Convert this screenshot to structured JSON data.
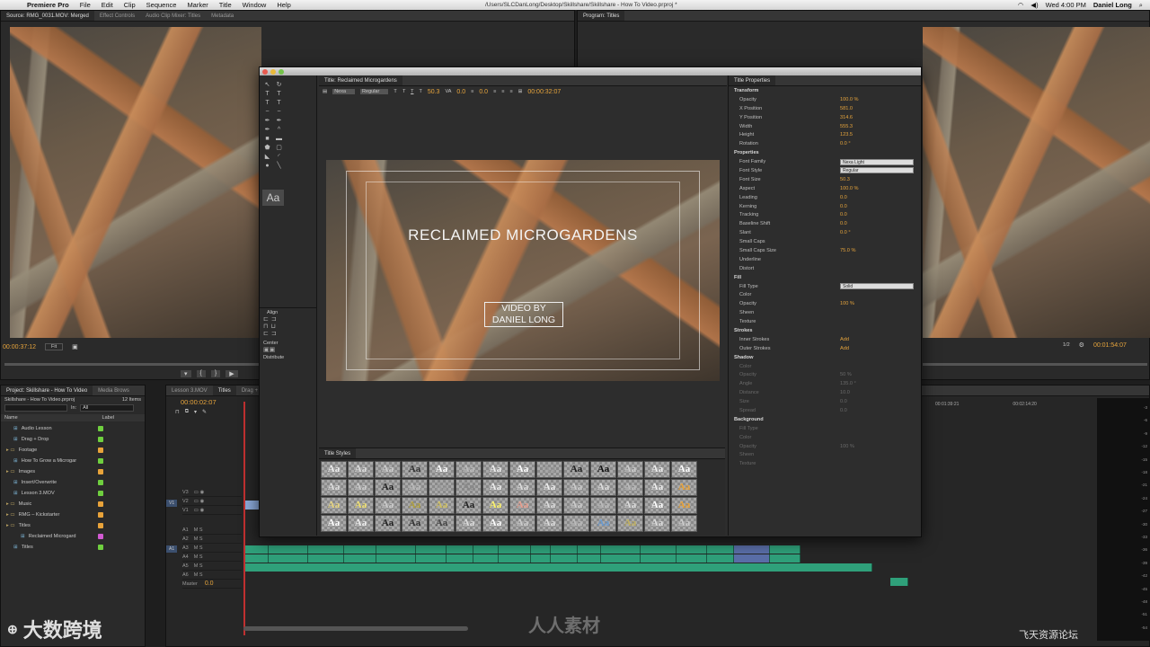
{
  "menubar": {
    "app": "Premiere Pro",
    "items": [
      "File",
      "Edit",
      "Clip",
      "Sequence",
      "Marker",
      "Title",
      "Window",
      "Help"
    ],
    "path": "/Users/SLCDanLong/Desktop/Skillshare/Skillshare - How To Video.prproj *",
    "clock": "Wed 4:00 PM",
    "user": "Daniel Long"
  },
  "source": {
    "tabs": [
      "Source: RMG_0031.MOV: Merged",
      "Effect Controls",
      "Audio Clip Mixer: Titles",
      "Metadata"
    ],
    "timecode": "00:00:37:12",
    "zoom": "Fit"
  },
  "program": {
    "tab": "Program: Titles",
    "timecode": "00:01:54:07",
    "ratio": "1/2"
  },
  "title": {
    "tab": "Title: Reclaimed Microgardens",
    "font": "Nexa",
    "style": "Regular",
    "size": "50.3",
    "kerning": "0.0",
    "leading": "0.0",
    "tc": "00:00:32:07",
    "main_text": "RECLAIMED MICROGARDENS",
    "sub_text": "VIDEO BY DANIEL LONG",
    "style_char": "Aa",
    "styles_tab": "Title Styles",
    "align": "Align",
    "center": "Center",
    "distribute": "Distribute"
  },
  "props": {
    "tab": "Title Properties",
    "rows": [
      {
        "n": "Transform",
        "v": "",
        "t": "sec"
      },
      {
        "n": "Opacity",
        "v": "100.0 %"
      },
      {
        "n": "X Position",
        "v": "581.0"
      },
      {
        "n": "Y Position",
        "v": "314.6"
      },
      {
        "n": "Width",
        "v": "555.3"
      },
      {
        "n": "Height",
        "v": "123.5"
      },
      {
        "n": "Rotation",
        "v": "0.0 °"
      },
      {
        "n": "Properties",
        "v": "",
        "t": "sec"
      },
      {
        "n": "Font Family",
        "v": "Nexa Light",
        "t": "sel"
      },
      {
        "n": "Font Style",
        "v": "Regular",
        "t": "sel"
      },
      {
        "n": "Font Size",
        "v": "50.3"
      },
      {
        "n": "Aspect",
        "v": "100.0 %"
      },
      {
        "n": "Leading",
        "v": "0.0"
      },
      {
        "n": "Kerning",
        "v": "0.0"
      },
      {
        "n": "Tracking",
        "v": "0.0"
      },
      {
        "n": "Baseline Shift",
        "v": "0.0"
      },
      {
        "n": "Slant",
        "v": "0.0 °"
      },
      {
        "n": "Small Caps",
        "v": ""
      },
      {
        "n": "Small Caps Size",
        "v": "75.0 %"
      },
      {
        "n": "Underline",
        "v": ""
      },
      {
        "n": "Distort",
        "v": ""
      },
      {
        "n": "Fill",
        "v": "",
        "t": "sec"
      },
      {
        "n": "Fill Type",
        "v": "Solid",
        "t": "sel"
      },
      {
        "n": "Color",
        "v": ""
      },
      {
        "n": "Opacity",
        "v": "100 %"
      },
      {
        "n": "Sheen",
        "v": ""
      },
      {
        "n": "Texture",
        "v": ""
      },
      {
        "n": "Strokes",
        "v": "",
        "t": "sec"
      },
      {
        "n": "Inner Strokes",
        "v": "Add"
      },
      {
        "n": "Outer Strokes",
        "v": "Add"
      },
      {
        "n": "Shadow",
        "v": "",
        "t": "sec"
      },
      {
        "n": "Color",
        "v": "",
        "t": "dim"
      },
      {
        "n": "Opacity",
        "v": "50 %",
        "t": "dim"
      },
      {
        "n": "Angle",
        "v": "135.0 °",
        "t": "dim"
      },
      {
        "n": "Distance",
        "v": "10.0",
        "t": "dim"
      },
      {
        "n": "Size",
        "v": "0.0",
        "t": "dim"
      },
      {
        "n": "Spread",
        "v": "0.0",
        "t": "dim"
      },
      {
        "n": "Background",
        "v": "",
        "t": "sec"
      },
      {
        "n": "Fill Type",
        "v": "",
        "t": "dim"
      },
      {
        "n": "Color",
        "v": "",
        "t": "dim"
      },
      {
        "n": "Opacity",
        "v": "100 %",
        "t": "dim"
      },
      {
        "n": "Sheen",
        "v": "",
        "t": "dim"
      },
      {
        "n": "Texture",
        "v": "",
        "t": "dim"
      }
    ]
  },
  "project": {
    "tabs": [
      "Project: Skillshare - How To Video",
      "Media Brows"
    ],
    "file": "Skillshare - How To Video.prproj",
    "count": "12 Items",
    "in_label": "In:",
    "in_value": "All",
    "col_name": "Name",
    "col_label": "Label",
    "items": [
      {
        "name": "Audio Lesson",
        "color": "#6fcf3f",
        "indent": 1
      },
      {
        "name": "Drag + Drop",
        "color": "#6fcf3f",
        "indent": 1
      },
      {
        "name": "Footage",
        "color": "#e8a33a",
        "indent": 0
      },
      {
        "name": "How To Grow a Microgar",
        "color": "#6fcf3f",
        "indent": 1
      },
      {
        "name": "Images",
        "color": "#e8a33a",
        "indent": 0
      },
      {
        "name": "Insert/Overwrite",
        "color": "#6fcf3f",
        "indent": 1
      },
      {
        "name": "Lesson 3.MOV",
        "color": "#6fcf3f",
        "indent": 1
      },
      {
        "name": "Music",
        "color": "#e8a33a",
        "indent": 0
      },
      {
        "name": "RMG – Kickstarter",
        "color": "#e8a33a",
        "indent": 0
      },
      {
        "name": "Titles",
        "color": "#e8a33a",
        "indent": 0
      },
      {
        "name": "Reclaimed Microgard",
        "color": "#d25ad2",
        "indent": 2
      },
      {
        "name": "Titles",
        "color": "#6fcf3f",
        "indent": 1
      }
    ]
  },
  "sequence": {
    "tabs": [
      "Lesson 3.MOV",
      "Titles",
      "Drag +"
    ],
    "timecode": "00:00:02:07",
    "tracks": [
      "V3",
      "V2",
      "V1",
      "A1",
      "A2",
      "A3",
      "A4",
      "A5",
      "A6"
    ],
    "master": "Master",
    "master_val": "0.0",
    "v_label": "V1",
    "a_label": "A1",
    "ruler": [
      "00:01:39:21",
      "00:02:14:20"
    ],
    "meter": [
      "-3",
      "-6",
      "-9",
      "-12",
      "-15",
      "-18",
      "-21",
      "-24",
      "-27",
      "-30",
      "-33",
      "-36",
      "-39",
      "-42",
      "-45",
      "-48",
      "-51",
      "-54"
    ]
  },
  "watermarks": {
    "left": "大数跨境",
    "center": "人人素材",
    "right": "飞天资源论坛"
  }
}
